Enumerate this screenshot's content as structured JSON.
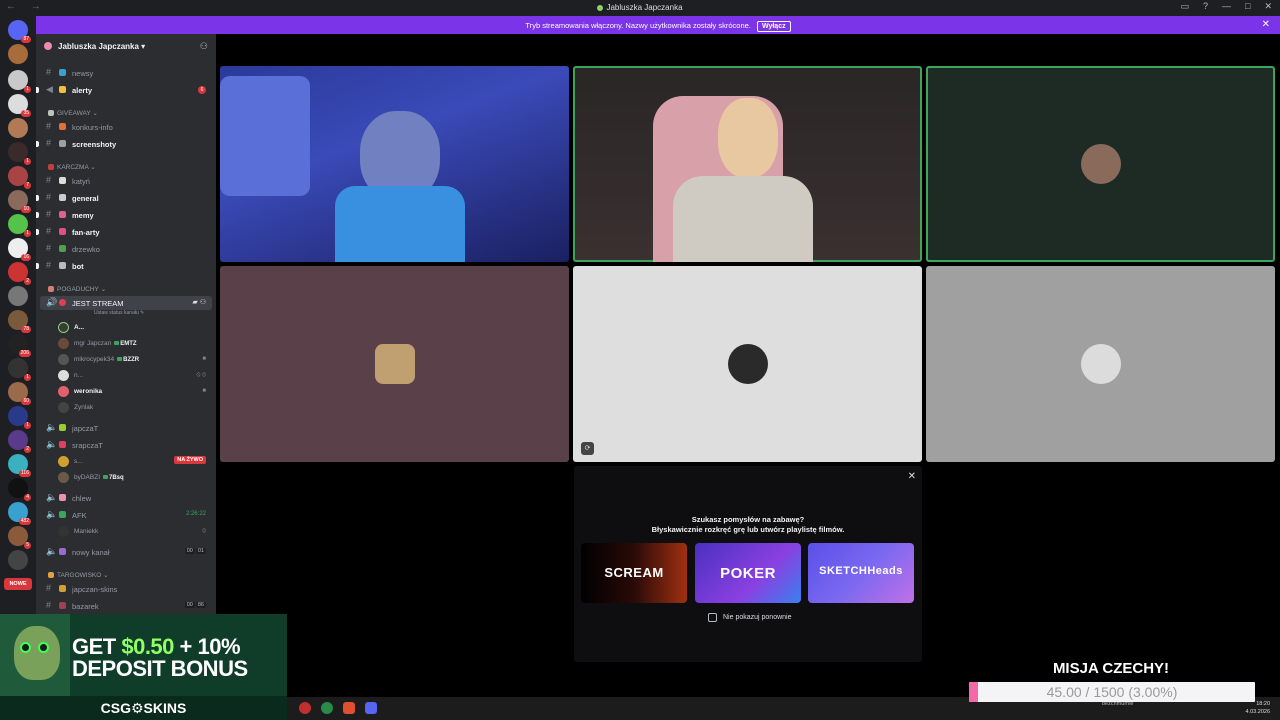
{
  "window": {
    "title": "Jabluszka Japczanka"
  },
  "banner": {
    "text": "Tryb streamowania włączony. Nazwy użytkownika zostały skrócone.",
    "button": "Wyłącz"
  },
  "server": {
    "name": "Jabluszka Japczanka"
  },
  "rail_badges": [
    "87",
    "1",
    "35",
    "1",
    "7",
    "10",
    "1",
    "16",
    "2",
    "78",
    "206",
    "1",
    "60",
    "1",
    "2",
    "116",
    "4",
    "482",
    "5",
    "NOWE"
  ],
  "channels": {
    "newsy": "newsy",
    "alerty": "alerty",
    "alerty_mentions": "6",
    "cat_giveaway": "GIVEAWAY",
    "konkurs": "konkurs-info",
    "screenshoty": "screenshoty",
    "cat_karczma": "KARCZMA",
    "katyn": "katyń",
    "general": "general",
    "memy": "memy",
    "fanarty": "fan-arty",
    "drzewko": "drzewko",
    "bot": "bot",
    "cat_pogaduchy": "POGADUCHY",
    "jest_stream": "JEST STREAM",
    "status_hint": "Ustaw status kanału",
    "japczat": "japczaT",
    "srapczat": "srapczaT",
    "live": "NA ŻYWO",
    "chlew": "chlew",
    "afk": "AFK",
    "afk_timer": "2:26:22",
    "nowy_kanal": "nowy kanał",
    "nowy_counts": [
      "00",
      "01"
    ],
    "cat_targowisko": "TARGOWISKO",
    "japczan_skins": "japczan-skins",
    "bazarek": "bazarek",
    "bazarek_counts": [
      "00",
      "86"
    ]
  },
  "voice_users": {
    "u1": "A...",
    "u2": "mgr Japczan",
    "u2_tag": "EMTZ",
    "u3": "mikrocypek34",
    "u3_tag": "BZZR",
    "u4": "n...",
    "u5": "weronika",
    "u6": "Zynlak",
    "u7": "s...",
    "u8": "byDABZI",
    "u8_tag": "7Bsq",
    "u9": "Maniekk"
  },
  "activities": {
    "heading": "Szukasz pomysłów na zabawę?",
    "subheading": "Błyskawicznie rozkręć grę lub utwórz playlistę filmów.",
    "tiles": [
      "SCREAM",
      "POKER",
      "SKETCHHeads"
    ],
    "dont_show": "Nie pokazuj ponownie"
  },
  "ad": {
    "line1a": "GET ",
    "line1b": "$0.50",
    "line1c": " + 10%",
    "line2": "DEPOSIT BONUS",
    "brand": "CSG⚙SKINS"
  },
  "taskbar": {
    "user": "bezchmurnie",
    "time": "18:20",
    "date": "4.03.2026"
  },
  "goal": {
    "title": "MISJA CZECHY!",
    "text": "45.00 / 1500 (3.00%)",
    "progress": 0.03
  },
  "colors": {
    "accent": "#7b34e8",
    "speaking": "#3ba55c",
    "mention": "#da373c",
    "goal_fill": "#f36aa8"
  }
}
